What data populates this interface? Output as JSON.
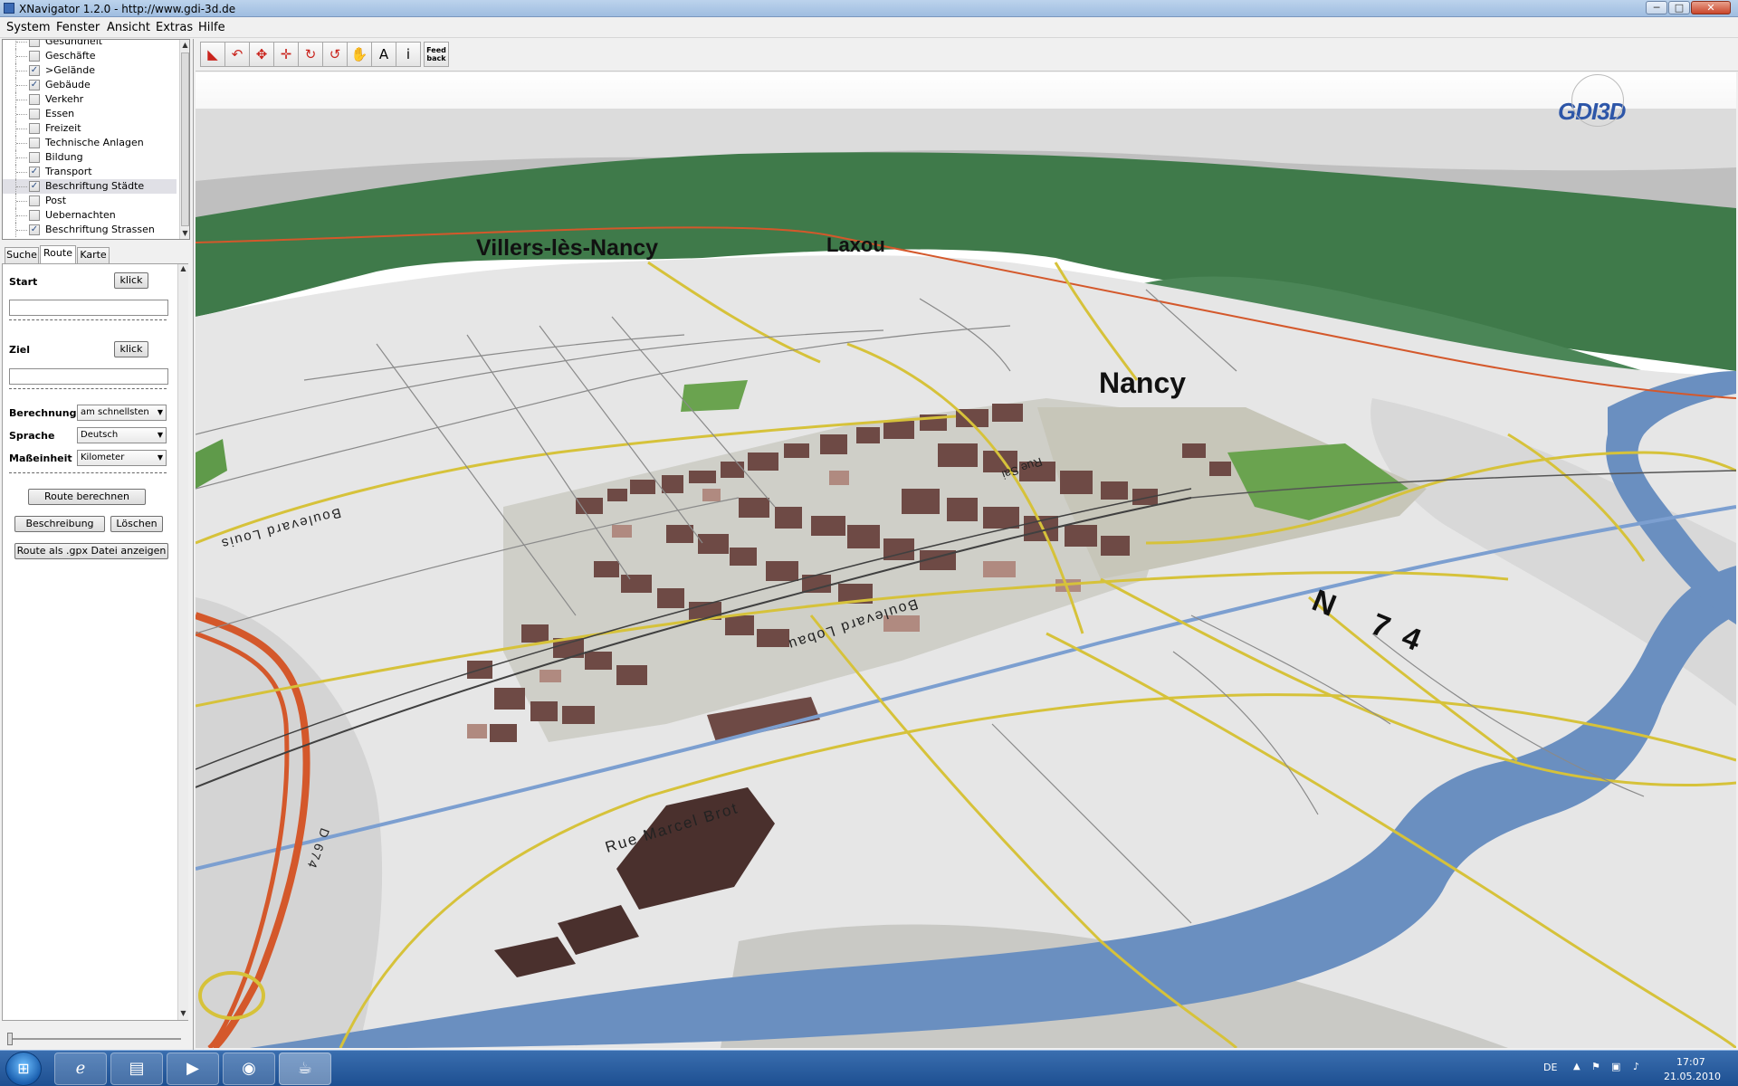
{
  "window": {
    "title": "XNavigator 1.2.0 - http://www.gdi-3d.de",
    "min_glyph": "─",
    "max_glyph": "□",
    "close_glyph": "✕"
  },
  "menu": [
    "System",
    "Fenster",
    "Ansicht",
    "Extras",
    "Hilfe"
  ],
  "layers": [
    {
      "label": "Gesundheit",
      "checked": false
    },
    {
      "label": "Geschäfte",
      "checked": false
    },
    {
      "label": ">Gelände",
      "checked": true
    },
    {
      "label": "Gebäude",
      "checked": true
    },
    {
      "label": "Verkehr",
      "checked": false
    },
    {
      "label": "Essen",
      "checked": false
    },
    {
      "label": "Freizeit",
      "checked": false
    },
    {
      "label": "Technische Anlagen",
      "checked": false
    },
    {
      "label": "Bildung",
      "checked": false
    },
    {
      "label": "Transport",
      "checked": true
    },
    {
      "label": "Beschriftung Städte",
      "checked": true
    },
    {
      "label": "Post",
      "checked": false
    },
    {
      "label": "Uebernachten",
      "checked": false
    },
    {
      "label": "Beschriftung Strassen",
      "checked": true
    }
  ],
  "selected_layer": "Beschriftung Städte",
  "tabs": [
    "Suche",
    "Route",
    "Karte"
  ],
  "active_tab": "Route",
  "route": {
    "start_label": "Start",
    "start_button": "klick",
    "start_value": "",
    "ziel_label": "Ziel",
    "ziel_button": "klick",
    "ziel_value": "",
    "berechnung_label": "Berechnung",
    "berechnung_value": "am schnellsten",
    "sprache_label": "Sprache",
    "sprache_value": "Deutsch",
    "masseinheit_label": "Maßeinheit",
    "masseinheit_value": "Kilometer",
    "calc_button": "Route berechnen",
    "desc_button": "Beschreibung",
    "delete_button": "Löschen",
    "gpx_button": "Route als .gpx Datei anzeigen"
  },
  "playback": {
    "slider_position": 0,
    "buttons": [
      "▶",
      "■",
      "◀◀",
      "▶▶",
      "◉",
      "−",
      "+"
    ]
  },
  "toolbar": {
    "tools": [
      {
        "name": "pan-red-icon",
        "glyph": "◣"
      },
      {
        "name": "rotate-red-icon",
        "glyph": "↶"
      },
      {
        "name": "move-arrows-icon",
        "glyph": "✥"
      },
      {
        "name": "move-cross-icon",
        "glyph": "✛"
      },
      {
        "name": "orbit-icon",
        "glyph": "↻"
      },
      {
        "name": "turn-icon",
        "glyph": "↺"
      },
      {
        "name": "hand-icon",
        "glyph": "✋"
      },
      {
        "name": "annotation-icon",
        "glyph": "A"
      },
      {
        "name": "info-icon",
        "glyph": "i"
      },
      {
        "name": "feedback-icon",
        "glyph": "Feed back"
      }
    ]
  },
  "map": {
    "logo": "GDI3D",
    "labels": {
      "villers": "Villers-lès-Nancy",
      "laxou": "Laxou",
      "nancy": "Nancy",
      "n74": "N 74",
      "rue_marcel": "Rue Marcel Brot",
      "boulevard_lobau": "Boulevard Lobau",
      "boulevard_louis": "Boulevard Louis",
      "rue_sai": "Rue Sai",
      "d674": "D 674"
    },
    "colors": {
      "forest": "#3f7a4a",
      "terrain": "#e6e6e6",
      "river": "#6a8fc0",
      "roads_major": "#d6c23a",
      "roads_highway": "#d4582b",
      "buildings": "#6e4a45"
    }
  },
  "taskbar": {
    "language": "DE",
    "time": "17:07",
    "date": "21.05.2010"
  }
}
